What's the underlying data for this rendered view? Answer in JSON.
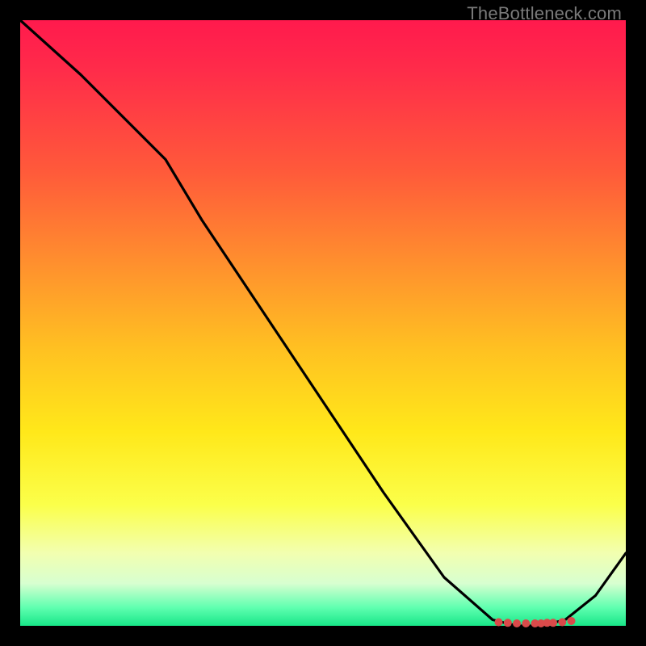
{
  "watermark": "TheBottleneck.com",
  "chart_data": {
    "type": "line",
    "title": "",
    "xlabel": "",
    "ylabel": "",
    "xlim": [
      0,
      100
    ],
    "ylim": [
      0,
      100
    ],
    "grid": false,
    "legend": false,
    "background_gradient": {
      "direction": "vertical",
      "stops": [
        {
          "pct": 0,
          "color": "#ff1a4d"
        },
        {
          "pct": 40,
          "color": "#ff8f2e"
        },
        {
          "pct": 68,
          "color": "#ffe81a"
        },
        {
          "pct": 88,
          "color": "#f2ffb0"
        },
        {
          "pct": 100,
          "color": "#18e688"
        }
      ]
    },
    "series": [
      {
        "name": "curve",
        "color": "#000000",
        "x": [
          0,
          10,
          20,
          24,
          30,
          40,
          50,
          60,
          70,
          78,
          82,
          86,
          90,
          95,
          100
        ],
        "y": [
          100,
          91,
          81,
          77,
          67,
          52,
          37,
          22,
          8,
          1,
          0,
          0,
          1,
          5,
          12
        ]
      }
    ],
    "markers": {
      "name": "bottom-cluster",
      "color": "#d94a4a",
      "shape": "circle",
      "x": [
        79,
        80.5,
        82,
        83.5,
        85,
        86,
        87,
        88,
        89.5,
        91
      ],
      "y": [
        0.6,
        0.5,
        0.4,
        0.4,
        0.4,
        0.4,
        0.5,
        0.5,
        0.6,
        0.8
      ]
    }
  }
}
